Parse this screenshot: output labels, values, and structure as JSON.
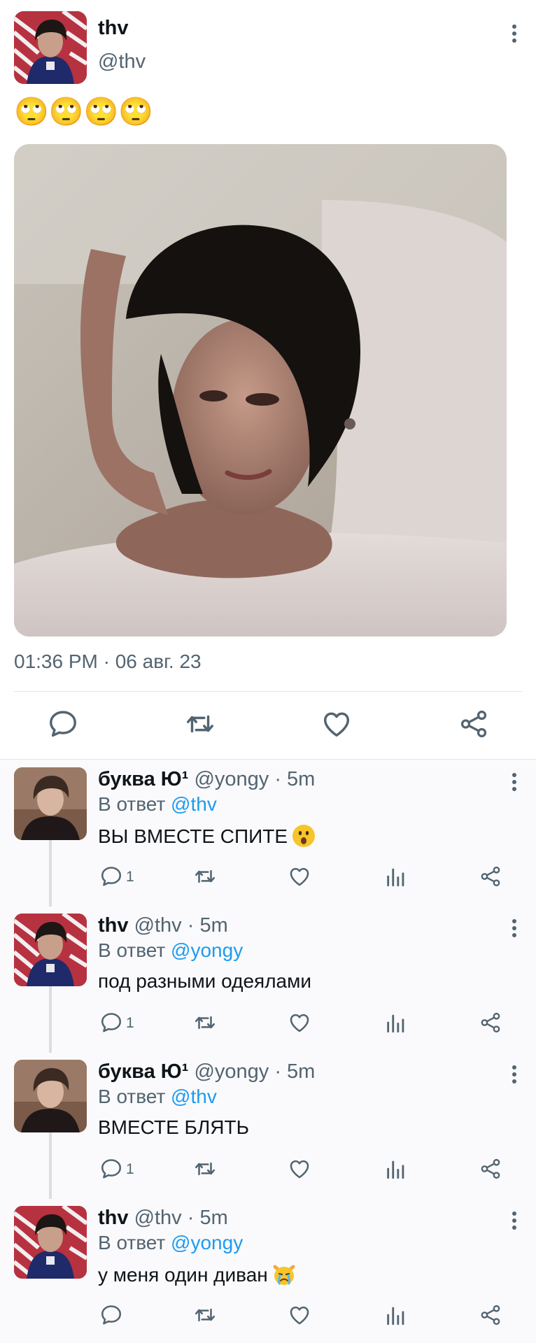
{
  "tweet": {
    "author_name": "thv",
    "author_handle": "@thv",
    "text_emoji": "🙄🙄🙄🙄",
    "timestamp": "01:36 PM · 06 авг. 23"
  },
  "actions": [
    "reply-icon",
    "retweet-icon",
    "like-icon",
    "share-icon"
  ],
  "replies": [
    {
      "name": "буква Ю¹",
      "handle": "@yongy",
      "time": "· 5m",
      "replying_to_label": "В ответ",
      "replying_to": "@thv",
      "text": "ВЫ ВМЕСТЕ СПИТЕ",
      "emoji": "hushed-face",
      "reply_count": "1"
    },
    {
      "name": "thv",
      "handle": "@thv",
      "time": "· 5m",
      "replying_to_label": "В ответ",
      "replying_to": "@yongy",
      "text": "под разными одеялами",
      "reply_count": "1"
    },
    {
      "name": "буква Ю¹",
      "handle": "@yongy",
      "time": "· 5m",
      "replying_to_label": "В ответ",
      "replying_to": "@thv",
      "text": "ВМЕСТЕ БЛЯТЬ",
      "reply_count": "1"
    },
    {
      "name": "thv",
      "handle": "@thv",
      "time": "· 5m",
      "replying_to_label": "В ответ",
      "replying_to": "@yongy",
      "text": "у меня один диван",
      "emoji": "crying-cat-face",
      "reply_count": ""
    }
  ],
  "colors": {
    "text": "#0f1419",
    "secondary": "#536471",
    "mention": "#1d9bf0",
    "icon": "#536471"
  }
}
